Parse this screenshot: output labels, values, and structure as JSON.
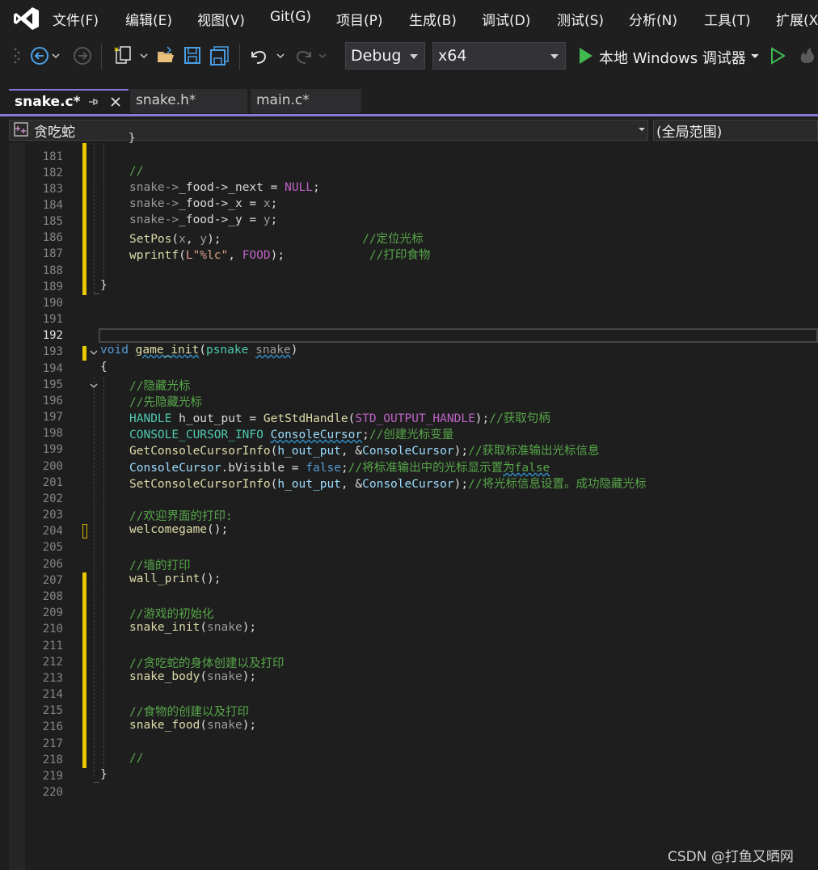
{
  "menubar": {
    "items": [
      "文件(F)",
      "编辑(E)",
      "视图(V)",
      "Git(G)",
      "项目(P)",
      "生成(B)",
      "调试(D)",
      "测试(S)",
      "分析(N)",
      "工具(T)",
      "扩展(X"
    ]
  },
  "toolbar": {
    "configuration": "Debug",
    "platform": "x64",
    "debugger": "本地 Windows 调试器"
  },
  "tabs": [
    {
      "label": "snake.c*",
      "active": true
    },
    {
      "label": "snake.h*",
      "active": false
    },
    {
      "label": "main.c*",
      "active": false
    }
  ],
  "navbar": {
    "scope": "贪吃蛇",
    "global": "(全局范围)"
  },
  "editor": {
    "line_numbers": [
      "181",
      "182",
      "183",
      "184",
      "185",
      "186",
      "187",
      "188",
      "189",
      "190",
      "191",
      "192",
      "193",
      "194",
      "195",
      "196",
      "197",
      "198",
      "199",
      "200",
      "201",
      "202",
      "203",
      "204",
      "205",
      "206",
      "207",
      "208",
      "209",
      "210",
      "211",
      "212",
      "213",
      "214",
      "215",
      "216",
      "217",
      "218",
      "219",
      "220"
    ],
    "lines": {
      "l181": "    }",
      "l182_c": "//",
      "l183_a": "snake->",
      "l183_b": "_food",
      "l183_c": "->",
      "l183_d": "_next",
      "l183_e": " = ",
      "l183_f": "NULL",
      "l183_g": ";",
      "l184_a": "snake->",
      "l184_b": "_food",
      "l184_c": "->",
      "l184_d": "_x",
      "l184_e": " = ",
      "l184_f": "x",
      "l184_g": ";",
      "l185_a": "snake->",
      "l185_b": "_food",
      "l185_c": "->",
      "l185_d": "_y",
      "l185_e": " = ",
      "l185_f": "y",
      "l185_g": ";",
      "l186_a": "SetPos",
      "l186_b": "(",
      "l186_c": "x",
      "l186_d": ", ",
      "l186_e": "y",
      "l186_f": ");",
      "l186_g": "                    ",
      "l186_h": "//定位光标",
      "l187_a": "wprintf",
      "l187_b": "(",
      "l187_c": "L\"%lc\"",
      "l187_d": ", ",
      "l187_e": "FOOD",
      "l187_f": ");",
      "l187_g": "            ",
      "l187_h": "//打印食物",
      "l189": "}",
      "l193_a": "void",
      "l193_b": " ",
      "l193_c": "game_init",
      "l193_d": "(",
      "l193_e": "psnake",
      "l193_f": " ",
      "l193_g": "snake",
      "l193_h": ")",
      "l194": "{",
      "l195": "//隐藏光标",
      "l196": "//先隐藏光标",
      "l197_a": "HANDLE",
      "l197_b": " h_out_put = ",
      "l197_c": "GetStdHandle",
      "l197_d": "(",
      "l197_e": "STD_OUTPUT_HANDLE",
      "l197_f": ");",
      "l197_g": "//获取句柄",
      "l198_a": "CONSOLE_CURSOR_INFO",
      "l198_b": " ",
      "l198_c": "ConsoleCursor",
      "l198_d": ";",
      "l198_e": "//创建光标变量",
      "l199_a": "GetConsoleCursorInfo",
      "l199_b": "(",
      "l199_c": "h_out_put",
      "l199_d": ", &",
      "l199_e": "ConsoleCursor",
      "l199_f": ");",
      "l199_g": "//获取标准输出光标信息",
      "l200_a": "ConsoleCursor",
      "l200_b": ".",
      "l200_c": "bVisible",
      "l200_d": " = ",
      "l200_e": "false",
      "l200_f": ";",
      "l200_g": "//将标准输出中的光标显示置",
      "l200_h": "为false",
      "l201_a": "SetConsoleCursorInfo",
      "l201_b": "(",
      "l201_c": "h_out_put",
      "l201_d": ", &",
      "l201_e": "ConsoleCursor",
      "l201_f": ");",
      "l201_g": "//将光标信息设置。成功隐藏光标",
      "l203": "//欢迎界面的打印:",
      "l204_a": "welcomegame",
      "l204_b": "();",
      "l206": "//墙的打印",
      "l207_a": "wall_print",
      "l207_b": "();",
      "l209": "//游戏的初始化",
      "l210_a": "snake_init",
      "l210_b": "(",
      "l210_c": "snake",
      "l210_d": ");",
      "l212": "//贪吃蛇的身体创建以及打印",
      "l213_a": "snake_body",
      "l213_b": "(",
      "l213_c": "snake",
      "l213_d": ");",
      "l215": "//食物的创建以及打印",
      "l216_a": "snake_food",
      "l216_b": "(",
      "l216_c": "snake",
      "l216_d": ");",
      "l218": "//",
      "l219": "}"
    }
  },
  "watermark": "CSDN @打鱼又晒网",
  "colors": {
    "accent": "#8c76d8",
    "change_marker": "#e8c900",
    "comment": "#57a64a",
    "keyword": "#569cd6",
    "function": "#dcdcaa",
    "type": "#4ec9b0",
    "macro": "#bd63c5"
  },
  "icons": [
    "vs-logo-icon",
    "back-icon",
    "forward-icon",
    "new-project-icon",
    "open-folder-icon",
    "save-icon",
    "save-all-icon",
    "undo-icon",
    "redo-icon",
    "play-icon",
    "start-without-debug-icon",
    "hot-reload-icon",
    "pin-icon",
    "close-icon",
    "class-icon"
  ]
}
